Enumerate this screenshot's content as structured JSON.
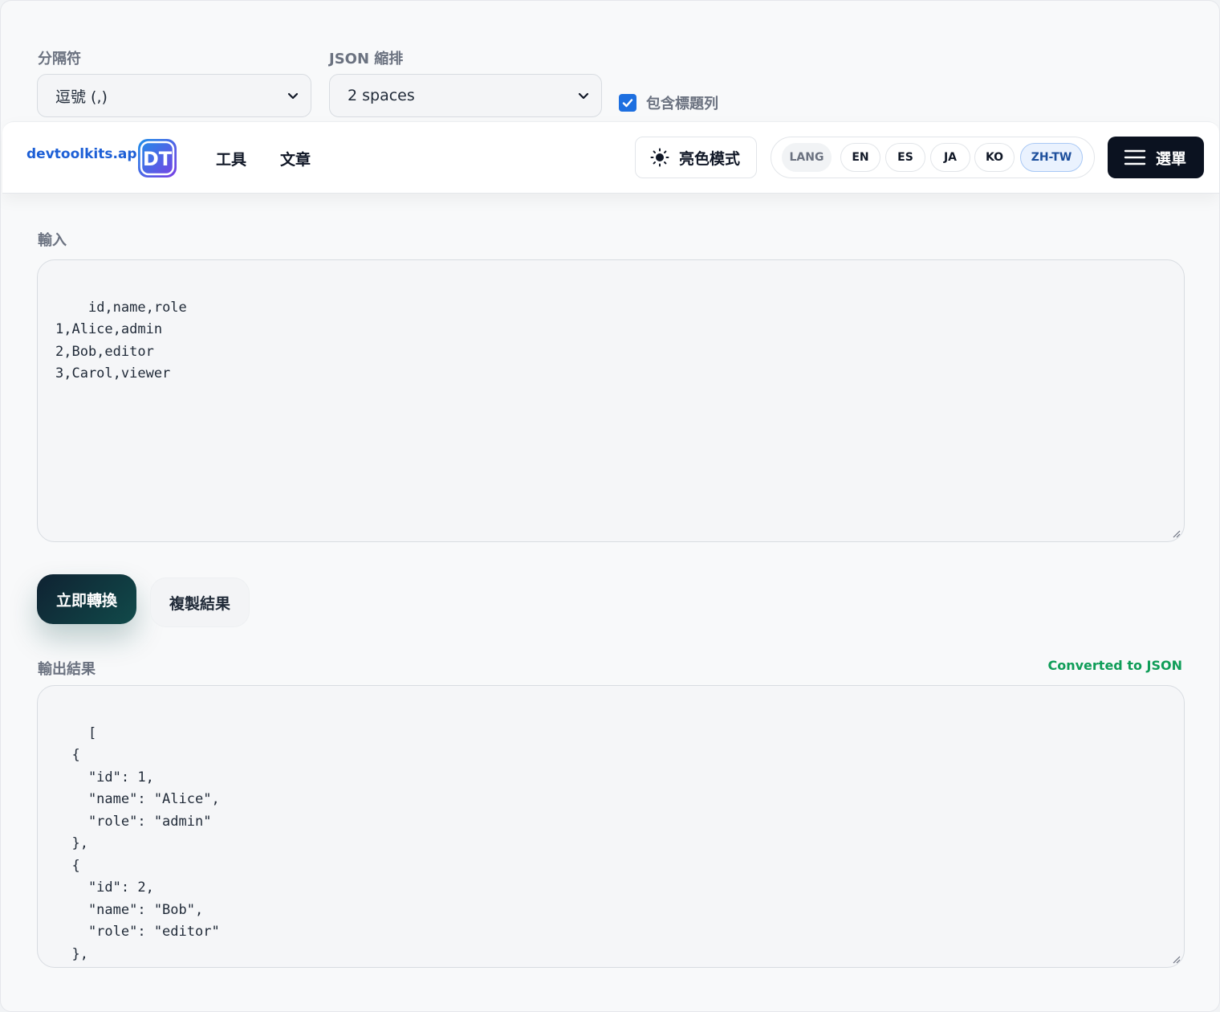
{
  "options": {
    "delimiter_label": "分隔符",
    "delimiter_value": "逗號 (,)",
    "indent_label": "JSON 縮排",
    "indent_value": "2 spaces",
    "header_row_label": "包含標題列",
    "header_row_checked": true
  },
  "header": {
    "brand": "devtoolkits.app",
    "logo_text": "DT",
    "nav": [
      "工具",
      "文章"
    ],
    "theme_button": "亮色模式",
    "lang_label": "LANG",
    "languages": [
      "EN",
      "ES",
      "JA",
      "KO",
      "ZH-TW"
    ],
    "active_language": "ZH-TW",
    "menu_button": "選單"
  },
  "input": {
    "label": "輸入",
    "text": "id,name,role\n1,Alice,admin\n2,Bob,editor\n3,Carol,viewer"
  },
  "actions": {
    "convert": "立即轉換",
    "copy": "複製結果"
  },
  "output": {
    "label": "輸出結果",
    "status": "Converted to JSON",
    "text": "[\n  {\n    \"id\": 1,\n    \"name\": \"Alice\",\n    \"role\": \"admin\"\n  },\n  {\n    \"id\": 2,\n    \"name\": \"Bob\",\n    \"role\": \"editor\"\n  },\n  {"
  },
  "colors": {
    "brand": "#1d5fd6",
    "checkbox": "#1d6fe0",
    "status": "#0f9d58",
    "menu_bg": "#0b1220"
  }
}
